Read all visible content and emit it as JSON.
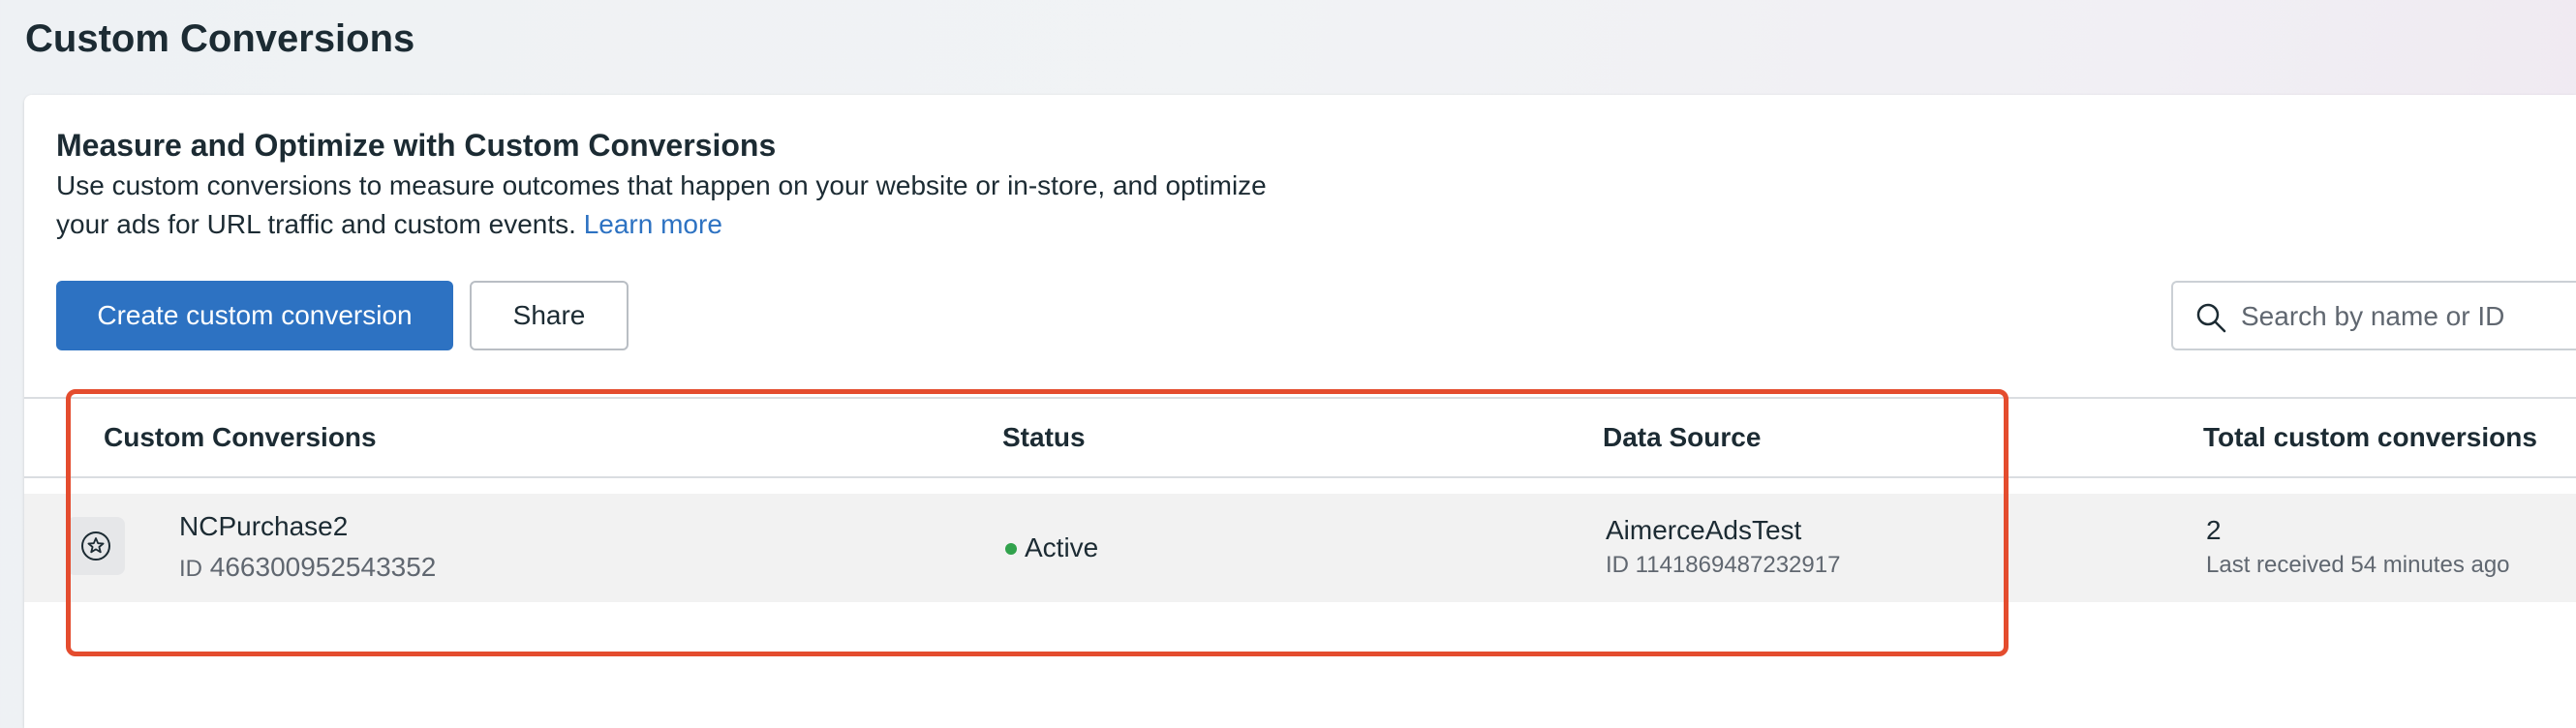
{
  "page": {
    "title": "Custom Conversions"
  },
  "intro": {
    "heading": "Measure and Optimize with Custom Conversions",
    "description": "Use custom conversions to measure outcomes that happen on your website or in-store, and optimize your ads for URL traffic and custom events.",
    "learn_more": "Learn more"
  },
  "toolbar": {
    "create_label": "Create custom conversion",
    "share_label": "Share",
    "search_placeholder": "Search by name or ID"
  },
  "table": {
    "columns": [
      "Custom Conversions",
      "Status",
      "Data Source",
      "Total custom conversions"
    ],
    "rows": [
      {
        "name": "NCPurchase2",
        "id_prefix": "ID",
        "id": "466300952543352",
        "status": "Active",
        "data_source_name": "AimerceAdsTest",
        "data_source_id": "ID 1141869487232917",
        "total": "2",
        "last_received": "Last received 54 minutes ago"
      }
    ]
  },
  "icons": {
    "search": "search-icon",
    "row": "star-icon"
  },
  "colors": {
    "primary": "#2d72c2",
    "active_status": "#31a24c",
    "highlight": "#e44c2e"
  }
}
